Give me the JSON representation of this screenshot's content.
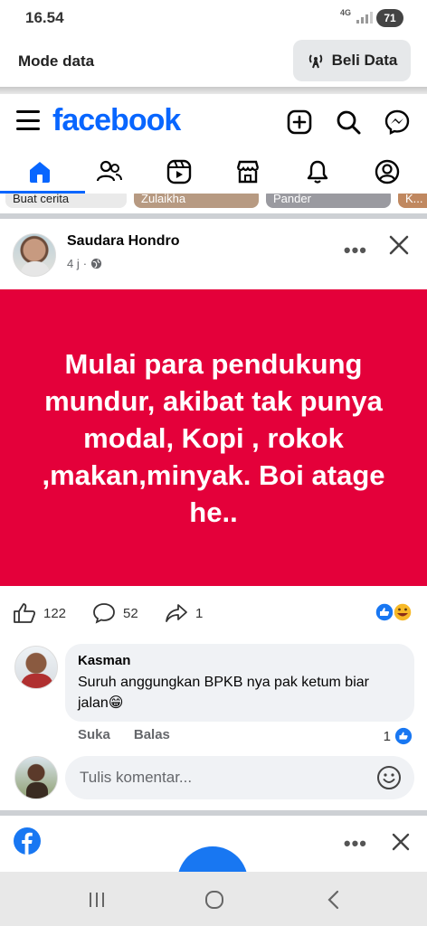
{
  "status": {
    "time": "16.54",
    "network": "4G",
    "battery": "71"
  },
  "modebar": {
    "label": "Mode data",
    "buy_label": "Beli Data"
  },
  "header": {
    "logo": "facebook"
  },
  "stories": {
    "labels": [
      "Buat cerita",
      "Zulaikha",
      "Pander",
      "K..."
    ]
  },
  "post": {
    "author": "Saudara Hondro",
    "time": "4 j",
    "dot": "·",
    "more": "•••",
    "text": "Mulai para pendukung mundur, akibat tak punya modal, Kopi , rokok ,makan,minyak. Boi atage he..",
    "bg_color": "#e4003a",
    "likes": "122",
    "comments": "52",
    "shares": "1"
  },
  "comment": {
    "author": "Kasman",
    "text": "Suruh anggungkan BPKB nya pak ketum biar jalan😁",
    "like_label": "Suka",
    "reply_label": "Balas",
    "like_count": "1"
  },
  "write": {
    "placeholder": "Tulis komentar..."
  },
  "next_post": {
    "more": "•••"
  },
  "colors": {
    "brand": "#0866ff",
    "post_bg": "#e4003a"
  }
}
